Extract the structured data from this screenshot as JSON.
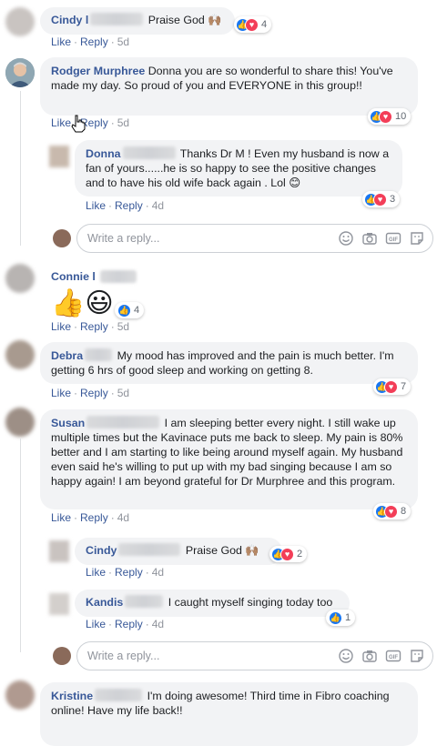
{
  "actions": {
    "like": "Like",
    "reply": "Reply",
    "dot": "·"
  },
  "comments": [
    {
      "name": "Cindy l",
      "text": "Praise God",
      "emoji": "🙌🏽",
      "reactions": "4",
      "time": "5d"
    },
    {
      "name": "Rodger Murphree",
      "text": "Donna you are so wonderful to share this! You've made my day. So proud of you and EVERYONE in this group!!",
      "reactions": "10",
      "time": "5d"
    },
    {
      "name": "Donna",
      "text": "Thanks Dr M ! Even my husband is now a fan of yours......he is so happy to see the positive changes and to have his old wife back again . Lol",
      "emoji": "😊",
      "reactions": "3",
      "time": "4d"
    },
    {
      "name": "Connie l",
      "emoji": "👍😃",
      "reactions": "4",
      "time": "5d"
    },
    {
      "name": "Debra",
      "text": "My mood has improved and the pain is much better. I'm getting 6 hrs of good sleep and working on getting 8.",
      "reactions": "7",
      "time": "5d"
    },
    {
      "name": "Susan",
      "text": "I am sleeping better every night. I still wake up multiple times but the Kavinace puts me back to sleep. My pain is 80% better and I am starting to like being around myself again. My husband even said he's willing to put up with my bad singing because I am so happy again! I am beyond grateful for Dr Murphree and this program.",
      "reactions": "8",
      "time": "4d"
    },
    {
      "name": "Cindy",
      "text": "Praise God",
      "emoji": "🙌🏽",
      "reactions": "2",
      "time": "4d"
    },
    {
      "name": "Kandis",
      "text": "I caught myself singing today too",
      "reactions": "1",
      "time": "4d"
    },
    {
      "name": "Kristine",
      "text": "I'm doing awesome! Third time in Fibro coaching online! Have my life back!!"
    }
  ],
  "reply_box": {
    "placeholder": "Write a reply..."
  },
  "icons": [
    "like-icon",
    "love-icon",
    "smiley-icon",
    "camera-icon",
    "gif-icon",
    "sticker-icon",
    "cursor-hand-icon"
  ]
}
